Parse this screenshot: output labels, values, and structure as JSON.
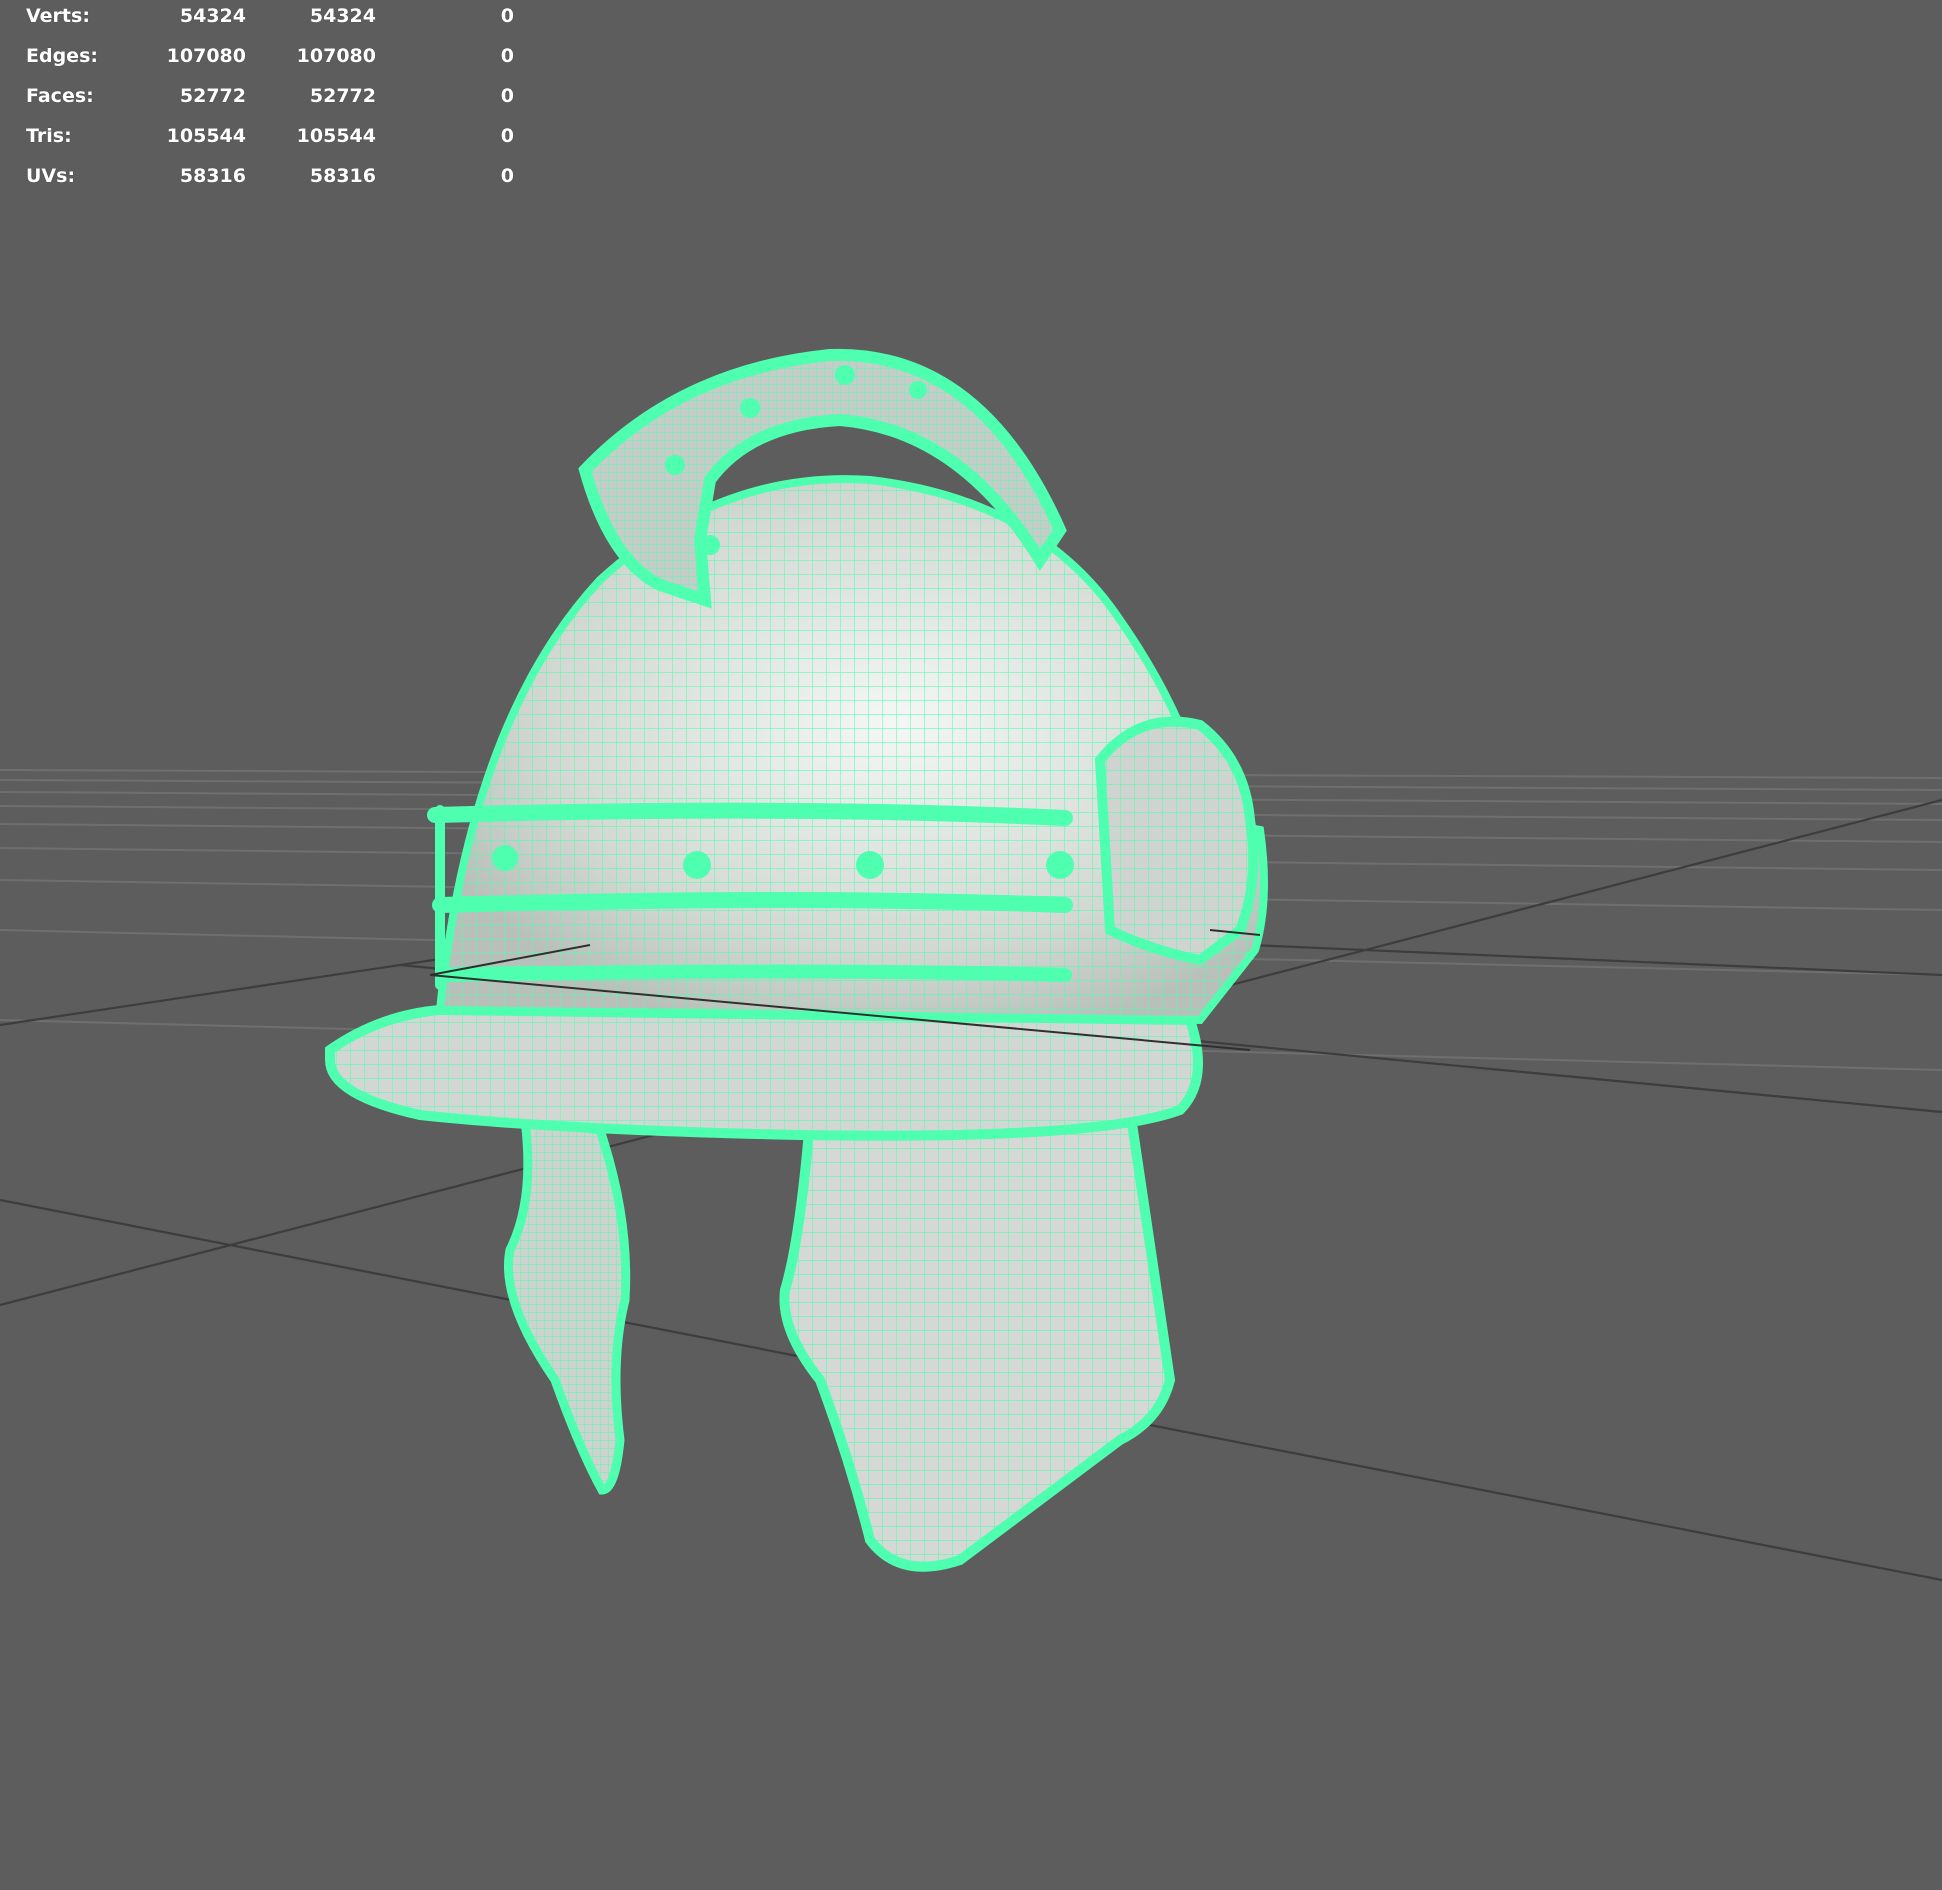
{
  "hud": {
    "rows": [
      {
        "label": "Verts:",
        "c1": "54324",
        "c2": "54324",
        "c3": "0"
      },
      {
        "label": "Edges:",
        "c1": "107080",
        "c2": "107080",
        "c3": "0"
      },
      {
        "label": "Faces:",
        "c1": "52772",
        "c2": "52772",
        "c3": "0"
      },
      {
        "label": "Tris:",
        "c1": "105544",
        "c2": "105544",
        "c3": "0"
      },
      {
        "label": "UVs:",
        "c1": "58316",
        "c2": "58316",
        "c3": "0"
      }
    ]
  },
  "colors": {
    "background": "#5d5d5d",
    "wireframe": "#4dffae",
    "surface": "#d9dcd8",
    "grid": "#6e6e6e"
  },
  "icons": [
    "helmet-model"
  ]
}
